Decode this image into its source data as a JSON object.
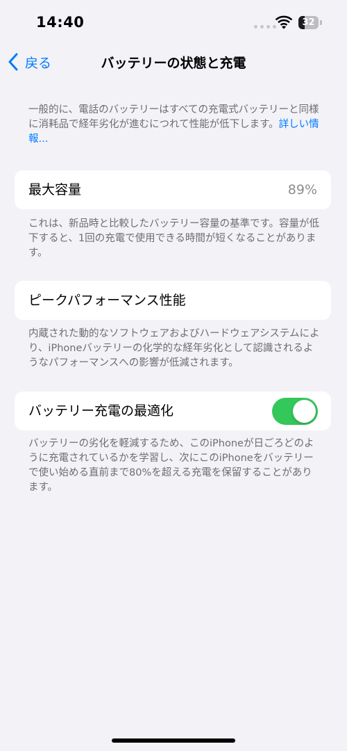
{
  "status_bar": {
    "time": "14:40",
    "battery_level": "32",
    "battery_fraction": 0.32
  },
  "nav": {
    "back_label": "戻る",
    "title": "バッテリーの状態と充電"
  },
  "intro": {
    "text": "一般的に、電話のバッテリーはすべての充電式バッテリーと同様に消耗品で経年劣化が進むにつれて性能が低下します。",
    "link": "詳しい情報..."
  },
  "max_capacity": {
    "label": "最大容量",
    "value": "89%",
    "note": "これは、新品時と比較したバッテリー容量の基準です。容量が低下すると、1回の充電で使用できる時間が短くなることがあります。"
  },
  "peak_performance": {
    "label": "ピークパフォーマンス性能",
    "note": "内蔵された動的なソフトウェアおよびハードウェアシステムにより、iPhoneバッテリーの化学的な経年劣化として認識されるようなパフォーマンスへの影響が低減されます。"
  },
  "optimized_charging": {
    "label": "バッテリー充電の最適化",
    "enabled": true,
    "note": "バッテリーの劣化を軽減するため、このiPhoneが日ごろどのように充電されているかを学習し、次にこのiPhoneをバッテリーで使い始める直前まで80%を超える充電を保留することがあります。"
  },
  "colors": {
    "accent": "#007aff",
    "toggle_on": "#34c759",
    "background": "#f2f2f7",
    "secondary_text": "#6d6d72"
  },
  "icons": {
    "back": "chevron-left-icon",
    "wifi": "wifi-icon",
    "battery": "battery-icon"
  }
}
